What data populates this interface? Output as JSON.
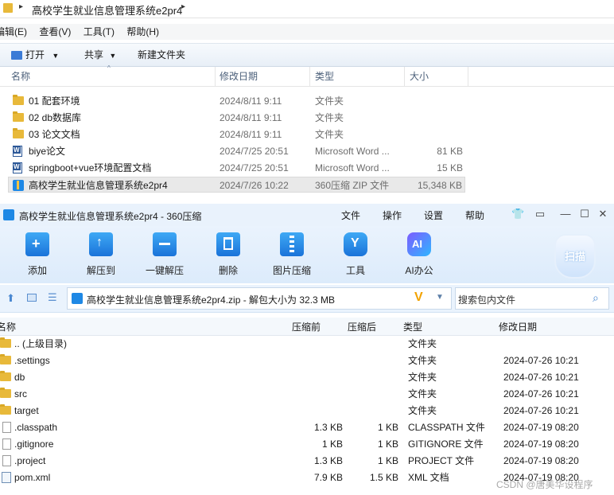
{
  "explorer": {
    "breadcrumb": "高校学生就业信息管理系统e2pr4",
    "menu": [
      "编辑(E)",
      "查看(V)",
      "工具(T)",
      "帮助(H)"
    ],
    "toolbar": {
      "open": "打开",
      "share": "共享",
      "new_folder": "新建文件夹"
    },
    "columns": {
      "name": "名称",
      "date": "修改日期",
      "type": "类型",
      "size": "大小"
    },
    "files": [
      {
        "name": "01 配套环境",
        "date": "2024/8/11 9:11",
        "type": "文件夹",
        "size": "",
        "icon": "folder-icon"
      },
      {
        "name": "02 db数据库",
        "date": "2024/8/11 9:11",
        "type": "文件夹",
        "size": "",
        "icon": "folder-icon"
      },
      {
        "name": "03 论文文档",
        "date": "2024/8/11 9:11",
        "type": "文件夹",
        "size": "",
        "icon": "folder-icon"
      },
      {
        "name": "biye论文",
        "date": "2024/7/25 20:51",
        "type": "Microsoft Word ...",
        "size": "81 KB",
        "icon": "word-doc-icon"
      },
      {
        "name": "springboot+vue环境配置文档",
        "date": "2024/7/25 20:51",
        "type": "Microsoft Word ...",
        "size": "15 KB",
        "icon": "word-doc-icon"
      },
      {
        "name": "高校学生就业信息管理系统e2pr4",
        "date": "2024/7/26 10:22",
        "type": "360压缩 ZIP 文件",
        "size": "15,348 KB",
        "icon": "zip-icon"
      }
    ]
  },
  "zip": {
    "title": "高校学生就业信息管理系统e2pr4 - 360压缩",
    "top_menu": [
      "文件",
      "操作",
      "设置",
      "帮助"
    ],
    "toolbar": [
      "添加",
      "解压到",
      "一键解压",
      "删除",
      "图片压缩",
      "工具",
      "AI办公"
    ],
    "toolbar_icons": [
      "add-icon",
      "extract-to-icon",
      "one-click-extract-icon",
      "delete-icon",
      "image-compress-icon",
      "tools-icon",
      "ai-office-icon"
    ],
    "scan_label": "扫描",
    "ai_badge": "AI",
    "path": "高校学生就业信息管理系统e2pr4.zip - 解包大小为 32.3 MB",
    "search_placeholder": "搜索包内文件",
    "columns": {
      "name": "名称",
      "before": "压缩前",
      "after": "压缩后",
      "type": "类型",
      "date": "修改日期"
    },
    "items": [
      {
        "name": ".. (上级目录)",
        "before": "",
        "after": "",
        "type": "文件夹",
        "date": "",
        "icon": "folder-icon"
      },
      {
        "name": ".settings",
        "before": "",
        "after": "",
        "type": "文件夹",
        "date": "2024-07-26 10:21",
        "icon": "folder-icon"
      },
      {
        "name": "db",
        "before": "",
        "after": "",
        "type": "文件夹",
        "date": "2024-07-26 10:21",
        "icon": "folder-icon"
      },
      {
        "name": "src",
        "before": "",
        "after": "",
        "type": "文件夹",
        "date": "2024-07-26 10:21",
        "icon": "folder-icon"
      },
      {
        "name": "target",
        "before": "",
        "after": "",
        "type": "文件夹",
        "date": "2024-07-26 10:21",
        "icon": "folder-icon"
      },
      {
        "name": ".classpath",
        "before": "1.3 KB",
        "after": "1 KB",
        "type": "CLASSPATH 文件",
        "date": "2024-07-19 08:20",
        "icon": "file-icon"
      },
      {
        "name": ".gitignore",
        "before": "1 KB",
        "after": "1 KB",
        "type": "GITIGNORE 文件",
        "date": "2024-07-19 08:20",
        "icon": "file-icon"
      },
      {
        "name": ".project",
        "before": "1.3 KB",
        "after": "1 KB",
        "type": "PROJECT 文件",
        "date": "2024-07-19 08:20",
        "icon": "file-icon"
      },
      {
        "name": "pom.xml",
        "before": "7.9 KB",
        "after": "1.5 KB",
        "type": "XML 文档",
        "date": "2024-07-19 08:20",
        "icon": "xml-file-icon"
      }
    ]
  },
  "watermark": "CSDN @唐美华设程序"
}
